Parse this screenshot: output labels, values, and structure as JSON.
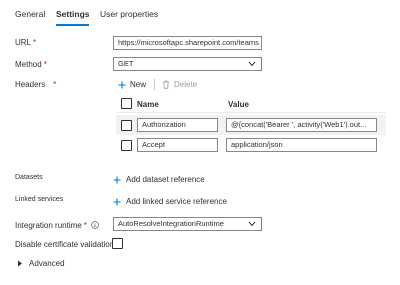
{
  "tabs": [
    {
      "label": "General"
    },
    {
      "label": "Settings"
    },
    {
      "label": "User properties"
    }
  ],
  "form": {
    "url_label": "URL",
    "url_value": "https://microsoftapc.sharepoint.com/teams",
    "method_label": "Method",
    "method_value": "GET",
    "headers_label": "Headers",
    "required_mark": "*",
    "new_label": "New",
    "delete_label": "Delete",
    "col_name": "Name",
    "col_value": "Value",
    "headers": [
      {
        "name": "Authorization",
        "value": "@{concat('Bearer ', activity('Web1').out..."
      },
      {
        "name": "Accept",
        "value": "application/json"
      }
    ],
    "datasets_label": "Datasets",
    "add_dataset_label": "Add dataset reference",
    "linked_services_label": "Linked services",
    "add_linked_label": "Add linked service reference",
    "ir_label": "Integration runtime",
    "ir_value": "AutoResolveIntegrationRuntime",
    "disable_cert_label": "Disable certificate validation",
    "advanced_label": "Advanced"
  },
  "colors": {
    "accent": "#0078d4",
    "required": "#a4262c",
    "text": "#323130"
  }
}
